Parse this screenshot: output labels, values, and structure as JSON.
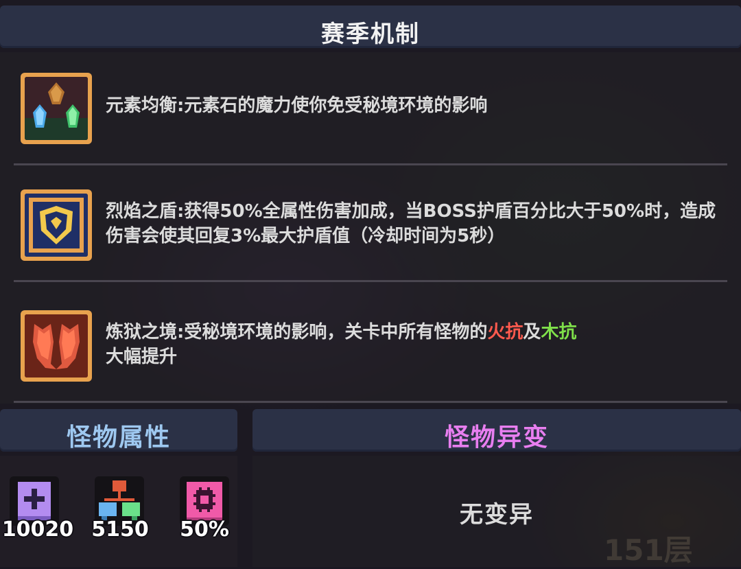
{
  "header": {
    "title": "赛季机制"
  },
  "mechanics": [
    {
      "name": "元素均衡",
      "desc_parts": [
        {
          "text": "元素均衡:元素石的魔力使你免受秘境环境的影响",
          "style": "normal"
        }
      ],
      "icon": "element-stones-icon"
    },
    {
      "name": "烈焰之盾",
      "desc_parts": [
        {
          "text": "烈焰之盾:获得50%全属性伤害加成，当BOSS护盾百分比大于50%时，造成伤害会使其回复3%最大护盾值（冷却时间为5秒）",
          "style": "normal"
        }
      ],
      "icon": "flame-shield-icon"
    },
    {
      "name": "炼狱之境",
      "desc_parts": [
        {
          "text": "炼狱之境:受秘境环境的影响，关卡中所有怪物的",
          "style": "normal"
        },
        {
          "text": "火抗",
          "style": "fire"
        },
        {
          "text": "及",
          "style": "normal"
        },
        {
          "text": "木抗",
          "style": "wood"
        },
        {
          "text": "大幅提升",
          "style": "normal"
        }
      ],
      "icon": "purgatory-wings-icon"
    }
  ],
  "monster_attributes": {
    "title": "怪物属性",
    "stats": [
      {
        "icon": "health-plus-icon",
        "value": "10020"
      },
      {
        "icon": "elements-tree-icon",
        "value": "5150"
      },
      {
        "icon": "gear-pink-icon",
        "value": "50%"
      }
    ]
  },
  "monster_mutation": {
    "title": "怪物异变",
    "value": "无变异"
  },
  "floor": {
    "label": "151层"
  },
  "colors": {
    "fire": "#ff5a4e",
    "wood": "#7fe04a",
    "attr_title": "#9ec8f0",
    "mutation_title": "#e87ef0",
    "icon_frame": "#e8a24e"
  }
}
